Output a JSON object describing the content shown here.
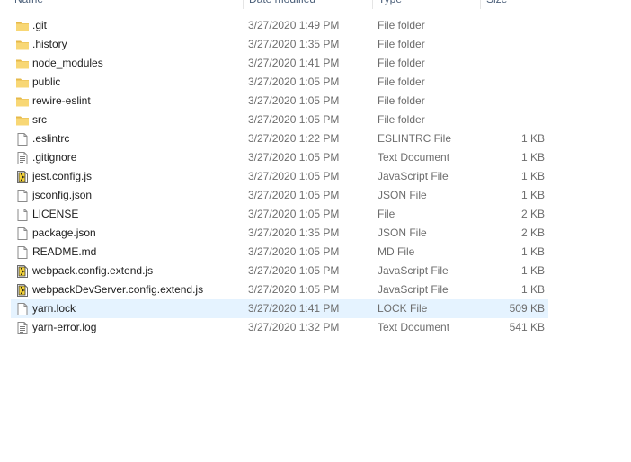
{
  "columns": {
    "name": "Name",
    "date": "Date modified",
    "type": "Type",
    "size": "Size"
  },
  "selected_index": 15,
  "files": [
    {
      "name": ".git",
      "date": "3/27/2020 1:49 PM",
      "type": "File folder",
      "size": "",
      "icon": "folder"
    },
    {
      "name": ".history",
      "date": "3/27/2020 1:35 PM",
      "type": "File folder",
      "size": "",
      "icon": "folder"
    },
    {
      "name": "node_modules",
      "date": "3/27/2020 1:41 PM",
      "type": "File folder",
      "size": "",
      "icon": "folder"
    },
    {
      "name": "public",
      "date": "3/27/2020 1:05 PM",
      "type": "File folder",
      "size": "",
      "icon": "folder"
    },
    {
      "name": "rewire-eslint",
      "date": "3/27/2020 1:05 PM",
      "type": "File folder",
      "size": "",
      "icon": "folder"
    },
    {
      "name": "src",
      "date": "3/27/2020 1:05 PM",
      "type": "File folder",
      "size": "",
      "icon": "folder"
    },
    {
      "name": ".eslintrc",
      "date": "3/27/2020 1:22 PM",
      "type": "ESLINTRC File",
      "size": "1 KB",
      "icon": "file"
    },
    {
      "name": ".gitignore",
      "date": "3/27/2020 1:05 PM",
      "type": "Text Document",
      "size": "1 KB",
      "icon": "text"
    },
    {
      "name": "jest.config.js",
      "date": "3/27/2020 1:05 PM",
      "type": "JavaScript File",
      "size": "1 KB",
      "icon": "script"
    },
    {
      "name": "jsconfig.json",
      "date": "3/27/2020 1:05 PM",
      "type": "JSON File",
      "size": "1 KB",
      "icon": "file"
    },
    {
      "name": "LICENSE",
      "date": "3/27/2020 1:05 PM",
      "type": "File",
      "size": "2 KB",
      "icon": "file"
    },
    {
      "name": "package.json",
      "date": "3/27/2020 1:35 PM",
      "type": "JSON File",
      "size": "2 KB",
      "icon": "file"
    },
    {
      "name": "README.md",
      "date": "3/27/2020 1:05 PM",
      "type": "MD File",
      "size": "1 KB",
      "icon": "file"
    },
    {
      "name": "webpack.config.extend.js",
      "date": "3/27/2020 1:05 PM",
      "type": "JavaScript File",
      "size": "1 KB",
      "icon": "script"
    },
    {
      "name": "webpackDevServer.config.extend.js",
      "date": "3/27/2020 1:05 PM",
      "type": "JavaScript File",
      "size": "1 KB",
      "icon": "script"
    },
    {
      "name": "yarn.lock",
      "date": "3/27/2020 1:41 PM",
      "type": "LOCK File",
      "size": "509 KB",
      "icon": "file"
    },
    {
      "name": "yarn-error.log",
      "date": "3/27/2020 1:32 PM",
      "type": "Text Document",
      "size": "541 KB",
      "icon": "text"
    }
  ],
  "colors": {
    "folder": "#f8d775",
    "folder_dark": "#e6b94a",
    "selection": "#e5f3ff",
    "header_text": "#4c607a"
  }
}
